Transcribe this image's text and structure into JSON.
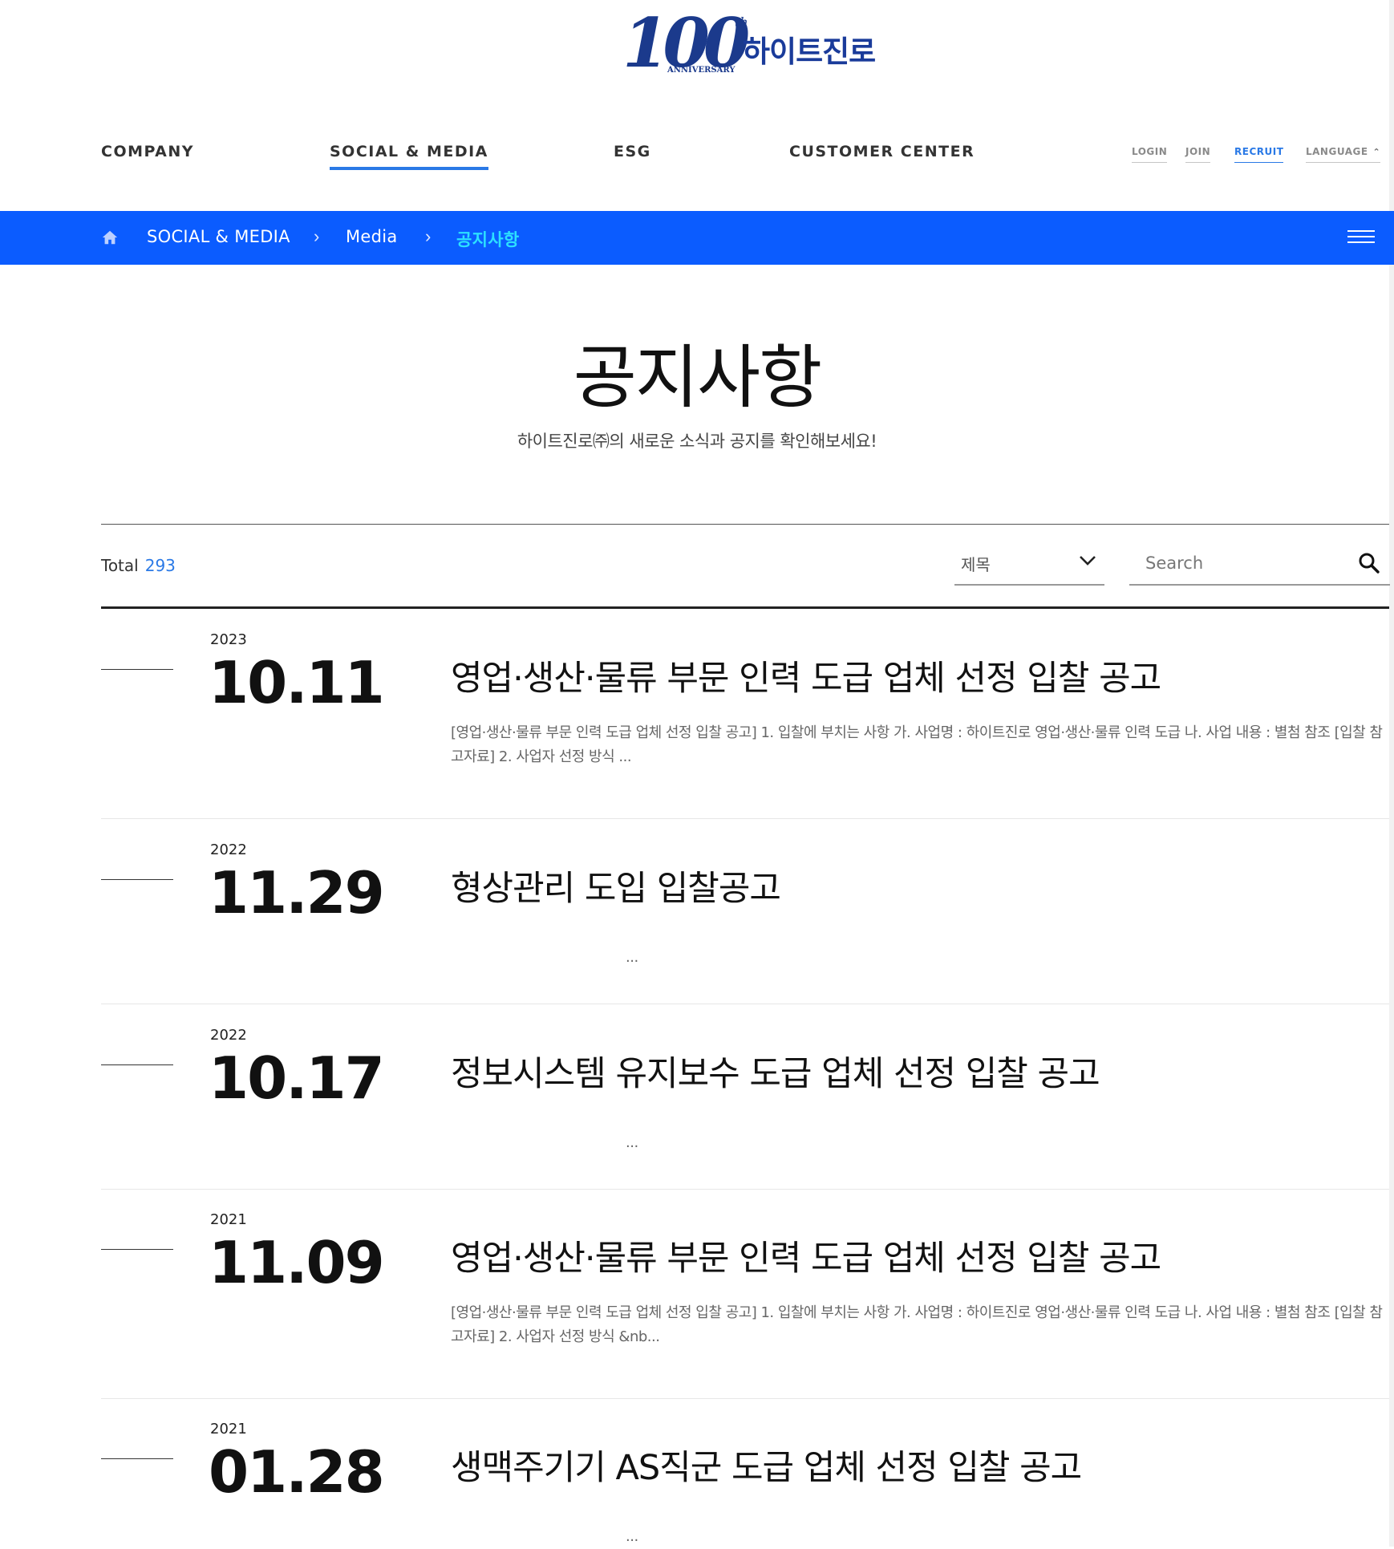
{
  "logo": {
    "number": "100",
    "superscript": "th",
    "subtext": "ANNIVERSARY",
    "brand": "하이트진로"
  },
  "nav": {
    "items": [
      {
        "label": "COMPANY",
        "active": false
      },
      {
        "label": "SOCIAL & MEDIA",
        "active": true
      },
      {
        "label": "ESG",
        "active": false
      },
      {
        "label": "CUSTOMER CENTER",
        "active": false
      }
    ],
    "util": {
      "login": "LOGIN",
      "join": "JOIN",
      "recruit": "RECRUIT",
      "language": "LANGUAGE",
      "language_icon": "chevron-up-icon"
    }
  },
  "breadcrumb": {
    "home_icon": "home-icon",
    "items": [
      "SOCIAL & MEDIA",
      "Media",
      "공지사항"
    ],
    "menu_icon": "hamburger-menu-icon"
  },
  "page": {
    "title": "공지사항",
    "subtitle": "하이트진로㈜의 새로운 소식과 공지를 확인해보세요!"
  },
  "list": {
    "total_label": "Total",
    "total_count": "293",
    "filter_selected": "제목",
    "search_placeholder": "Search",
    "items": [
      {
        "year": "2023",
        "date": "10.11",
        "title": "영업·생산·물류 부문 인력 도급 업체 선정 입찰 공고",
        "summary": "[영업·생산·물류 부문 인력 도급 업체 선정 입찰 공고] 1. 입찰에 부치는 사항   가. 사업명 : 하이트진로 영업·생산·물류 인력 도급   나. 사업 내용 : 별첨 참조 [입찰 참고자료] 2. 사업자 선정 방식 ..."
      },
      {
        "year": "2022",
        "date": "11.29",
        "title": "형상관리 도입 입찰공고",
        "summary": "..."
      },
      {
        "year": "2022",
        "date": "10.17",
        "title": "정보시스템 유지보수 도급 업체 선정 입찰 공고",
        "summary": "..."
      },
      {
        "year": "2021",
        "date": "11.09",
        "title": "영업·생산·물류 부문 인력 도급 업체 선정 입찰 공고",
        "summary": "[영업·생산·물류 부문 인력 도급 업체 선정 입찰 공고] 1. 입찰에 부치는 사항   가. 사업명 : 하이트진로 영업·생산·물류 인력 도급   나. 사업 내용 : 별첨 참조 [입찰 참고자료] 2. 사업자 선정 방식  &nb..."
      },
      {
        "year": "2021",
        "date": "01.28",
        "title": "생맥주기기 AS직군 도급 업체 선정 입찰 공고",
        "summary": "..."
      }
    ]
  },
  "colors": {
    "accent": "#0b5cff",
    "link": "#2a79e6",
    "crumb_current": "#2ce0ff",
    "brand_navy": "#1b3a8c"
  }
}
